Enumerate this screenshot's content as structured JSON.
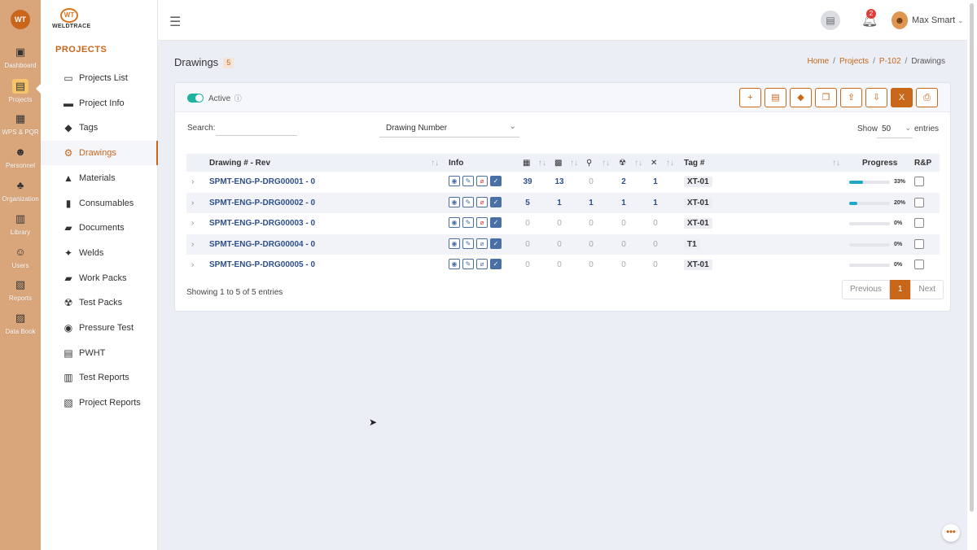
{
  "rail": {
    "logo": "WT",
    "items": [
      {
        "label": "Dashboard",
        "icon": "dashboard-icon",
        "glyph": "▣"
      },
      {
        "label": "Projects",
        "icon": "projects-icon",
        "glyph": "▤"
      },
      {
        "label": "WPS & PQR",
        "icon": "wps-icon",
        "glyph": "▦"
      },
      {
        "label": "Personnel",
        "icon": "personnel-icon",
        "glyph": "☻"
      },
      {
        "label": "Organization",
        "icon": "organization-icon",
        "glyph": "♣"
      },
      {
        "label": "Library",
        "icon": "library-icon",
        "glyph": "▥"
      },
      {
        "label": "Users",
        "icon": "users-icon",
        "glyph": "☺"
      },
      {
        "label": "Reports",
        "icon": "reports-icon",
        "glyph": "▧"
      },
      {
        "label": "Data Book",
        "icon": "databook-icon",
        "glyph": "▨"
      }
    ]
  },
  "brand": {
    "mark": "WT",
    "name": "WELDTRACE"
  },
  "sidebar": {
    "section_title": "PROJECTS",
    "items": [
      {
        "label": "Projects List",
        "icon": "folder-icon",
        "glyph": "▭"
      },
      {
        "label": "Project Info",
        "icon": "truck-icon",
        "glyph": "▬"
      },
      {
        "label": "Tags",
        "icon": "tag-icon",
        "glyph": "◆"
      },
      {
        "label": "Drawings",
        "icon": "drawing-icon",
        "glyph": "⚙"
      },
      {
        "label": "Materials",
        "icon": "materials-icon",
        "glyph": "▲"
      },
      {
        "label": "Consumables",
        "icon": "consumables-icon",
        "glyph": "▮"
      },
      {
        "label": "Documents",
        "icon": "documents-icon",
        "glyph": "▰"
      },
      {
        "label": "Welds",
        "icon": "welds-icon",
        "glyph": "✦"
      },
      {
        "label": "Work Packs",
        "icon": "workpacks-icon",
        "glyph": "▰"
      },
      {
        "label": "Test Packs",
        "icon": "testpacks-icon",
        "glyph": "☢"
      },
      {
        "label": "Pressure Test",
        "icon": "pressure-icon",
        "glyph": "◉"
      },
      {
        "label": "PWHT",
        "icon": "pwht-icon",
        "glyph": "▤"
      },
      {
        "label": "Test Reports",
        "icon": "testreports-icon",
        "glyph": "▥"
      },
      {
        "label": "Project Reports",
        "icon": "projectreports-icon",
        "glyph": "▧"
      }
    ]
  },
  "topbar": {
    "notifications": "2",
    "user_name": "Max Smart"
  },
  "page": {
    "title": "Drawings",
    "count": "5",
    "breadcrumb": [
      "Home",
      "Projects",
      "P-102",
      "Drawings"
    ]
  },
  "card": {
    "active_label": "Active",
    "search_label": "Search:",
    "search_value": "",
    "filter_select": "Drawing Number",
    "show_label": "Show",
    "show_value": "50",
    "entries_label": "entries",
    "actions": [
      "plus-icon",
      "list-icon",
      "tags-icon",
      "copy-icon",
      "upload-icon",
      "download-icon",
      "excel-icon",
      "print-icon"
    ],
    "action_glyphs": [
      "+",
      "▤",
      "◆",
      "❐",
      "⇪",
      "⇩",
      "X",
      "⎙"
    ]
  },
  "table": {
    "headers": {
      "drawing": "Drawing # - Rev",
      "info": "Info",
      "tag": "Tag #",
      "progress": "Progress",
      "rp": "R&P"
    },
    "rows": [
      {
        "drawing": "SPMT-ENG-P-DRG00001 - 0",
        "c1": "39",
        "c2": "13",
        "c3": "0",
        "c4": "2",
        "c5": "1",
        "tag": "XT-01",
        "progress": 0.33,
        "pct": "33%",
        "attach_red": true
      },
      {
        "drawing": "SPMT-ENG-P-DRG00002 - 0",
        "c1": "5",
        "c2": "1",
        "c3": "1",
        "c4": "1",
        "c5": "1",
        "tag": "XT-01",
        "progress": 0.2,
        "pct": "20%",
        "attach_red": true
      },
      {
        "drawing": "SPMT-ENG-P-DRG00003 - 0",
        "c1": "0",
        "c2": "0",
        "c3": "0",
        "c4": "0",
        "c5": "0",
        "tag": "XT-01",
        "progress": 0,
        "pct": "0%",
        "attach_red": true
      },
      {
        "drawing": "SPMT-ENG-P-DRG00004 - 0",
        "c1": "0",
        "c2": "0",
        "c3": "0",
        "c4": "0",
        "c5": "0",
        "tag": "T1",
        "progress": 0,
        "pct": "0%",
        "attach_red": false
      },
      {
        "drawing": "SPMT-ENG-P-DRG00005 - 0",
        "c1": "0",
        "c2": "0",
        "c3": "0",
        "c4": "0",
        "c5": "0",
        "tag": "XT-01",
        "progress": 0,
        "pct": "0%",
        "attach_red": false
      }
    ],
    "footer": "Showing 1 to 5 of 5 entries",
    "pager": {
      "prev": "Previous",
      "current": "1",
      "next": "Next"
    }
  },
  "colors": {
    "accent": "#c8661a",
    "rail": "#d9a57a",
    "link": "#2e4f8c",
    "progress": "#20a7c9",
    "toggle": "#20b2a0"
  }
}
